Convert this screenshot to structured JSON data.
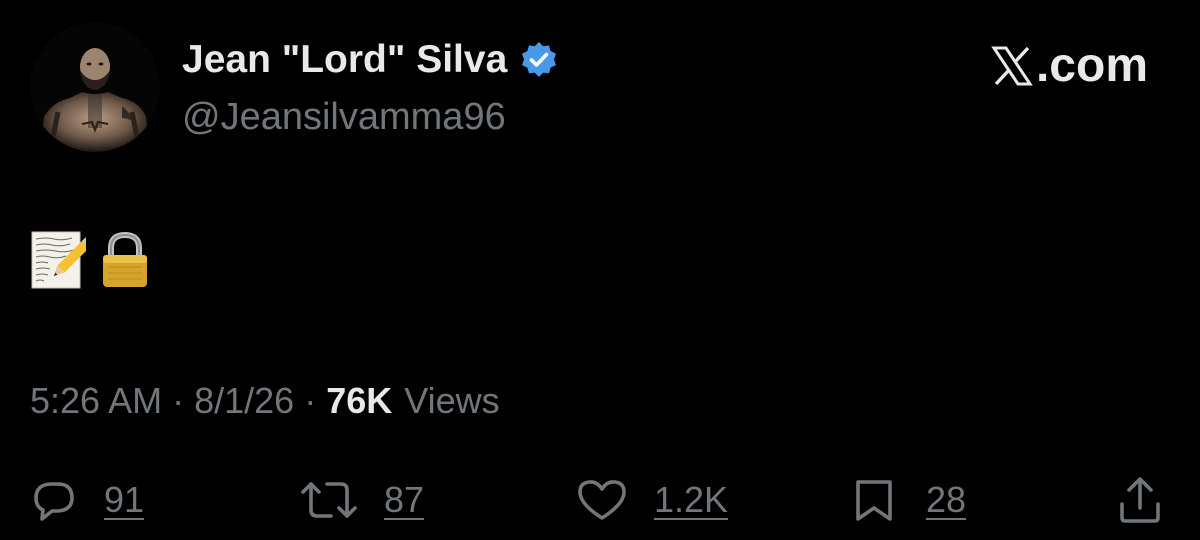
{
  "author": {
    "display_name": "Jean \"Lord\" Silva",
    "handle": "@Jeansilvamma96",
    "verified": true,
    "verified_color": "#4a99e9",
    "avatar_icon": "profile-photo"
  },
  "brand": {
    "label": ".com",
    "icon": "x-logo-icon"
  },
  "tweet": {
    "content_icons": [
      "memo-pencil-emoji",
      "lock-emoji"
    ]
  },
  "meta": {
    "time": "5:26 AM",
    "separator": "·",
    "date": "8/1/26",
    "views_count": "76K",
    "views_label": "Views"
  },
  "actions": {
    "replies": "91",
    "reposts": "87",
    "likes": "1.2K",
    "bookmarks": "28"
  },
  "colors": {
    "background": "#000000",
    "primary_text": "#e7e9ea",
    "secondary_text": "#71767b"
  }
}
